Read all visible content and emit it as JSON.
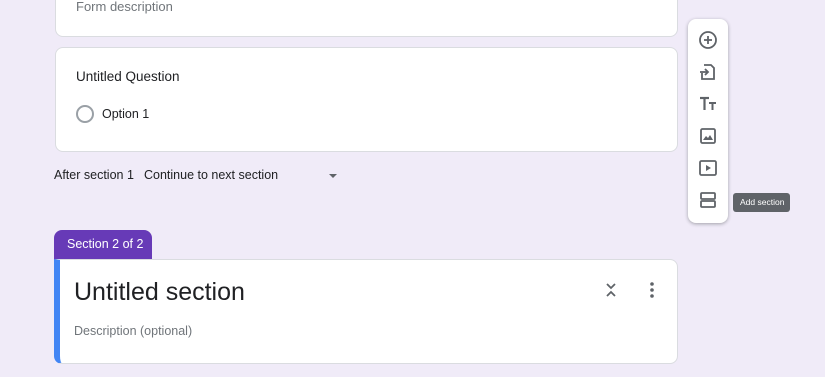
{
  "form": {
    "description_placeholder": "Form description"
  },
  "question": {
    "title": "Untitled Question",
    "options": [
      "Option 1"
    ]
  },
  "after_section": {
    "label": "After section 1",
    "selected": "Continue to next section"
  },
  "section2": {
    "tab_label": "Section 2 of 2",
    "title": "Untitled section",
    "description_placeholder": "Description (optional)"
  },
  "toolbar": {
    "items": [
      {
        "icon": "add-question-icon"
      },
      {
        "icon": "import-questions-icon"
      },
      {
        "icon": "add-title-icon"
      },
      {
        "icon": "add-image-icon"
      },
      {
        "icon": "add-video-icon"
      },
      {
        "icon": "add-section-icon"
      }
    ],
    "tooltip": "Add section"
  },
  "colors": {
    "background": "#f0ebf8",
    "accent": "#673ab7",
    "section_border": "#4285f4",
    "icon": "#5f6368"
  }
}
